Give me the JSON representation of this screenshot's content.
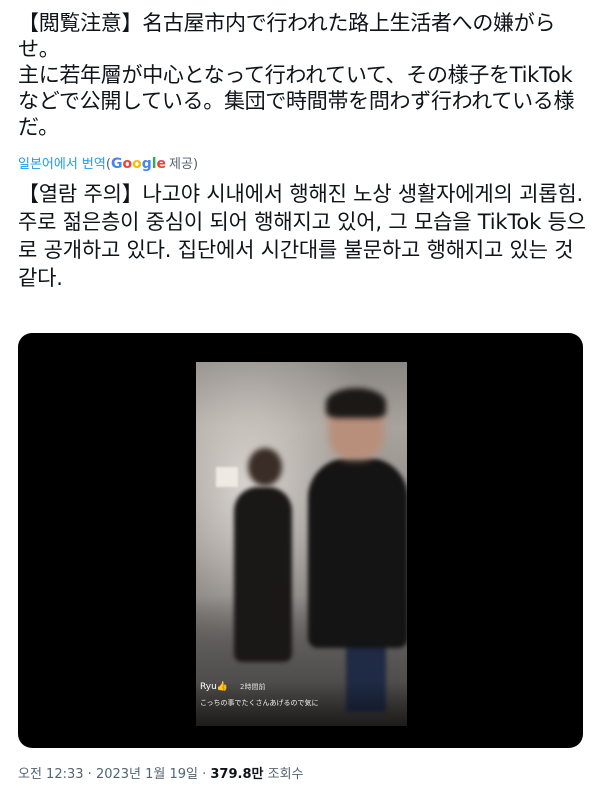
{
  "tweet": {
    "original_text": "【閲覧注意】名古屋市内で行われた路上生活者への嫌がらせ。\n主に若年層が中心となって行われていて、その様子をTikTokなどで公開している。集団で時間帯を問わず行われている様だ。",
    "translate_link": "일본어에서 번역",
    "translate_paren_open": "(",
    "google_letters": [
      "G",
      "o",
      "o",
      "g",
      "l",
      "e"
    ],
    "translate_provider": "제공)",
    "translated_text": "【열람 주의】나고야 시내에서 행해진 노상 생활자에게의 괴롭힘.\n주로 젊은층이 중심이 되어 행해지고 있어, 그 모습을 TikTok 등으로 공개하고 있다. 집단에서 시간대를 불문하고 행해지고 있는 것 같다.",
    "media": {
      "overlay_user": "Ryu👍",
      "overlay_time": "2時間前",
      "overlay_caption": "こっちの事でたくさんあげるので気に"
    },
    "meta": {
      "time": "오전 12:33",
      "sep1": " · ",
      "date": "2023년 1월 19일",
      "sep2": " · ",
      "views": "379.8만",
      "views_label": " 조회수"
    }
  }
}
